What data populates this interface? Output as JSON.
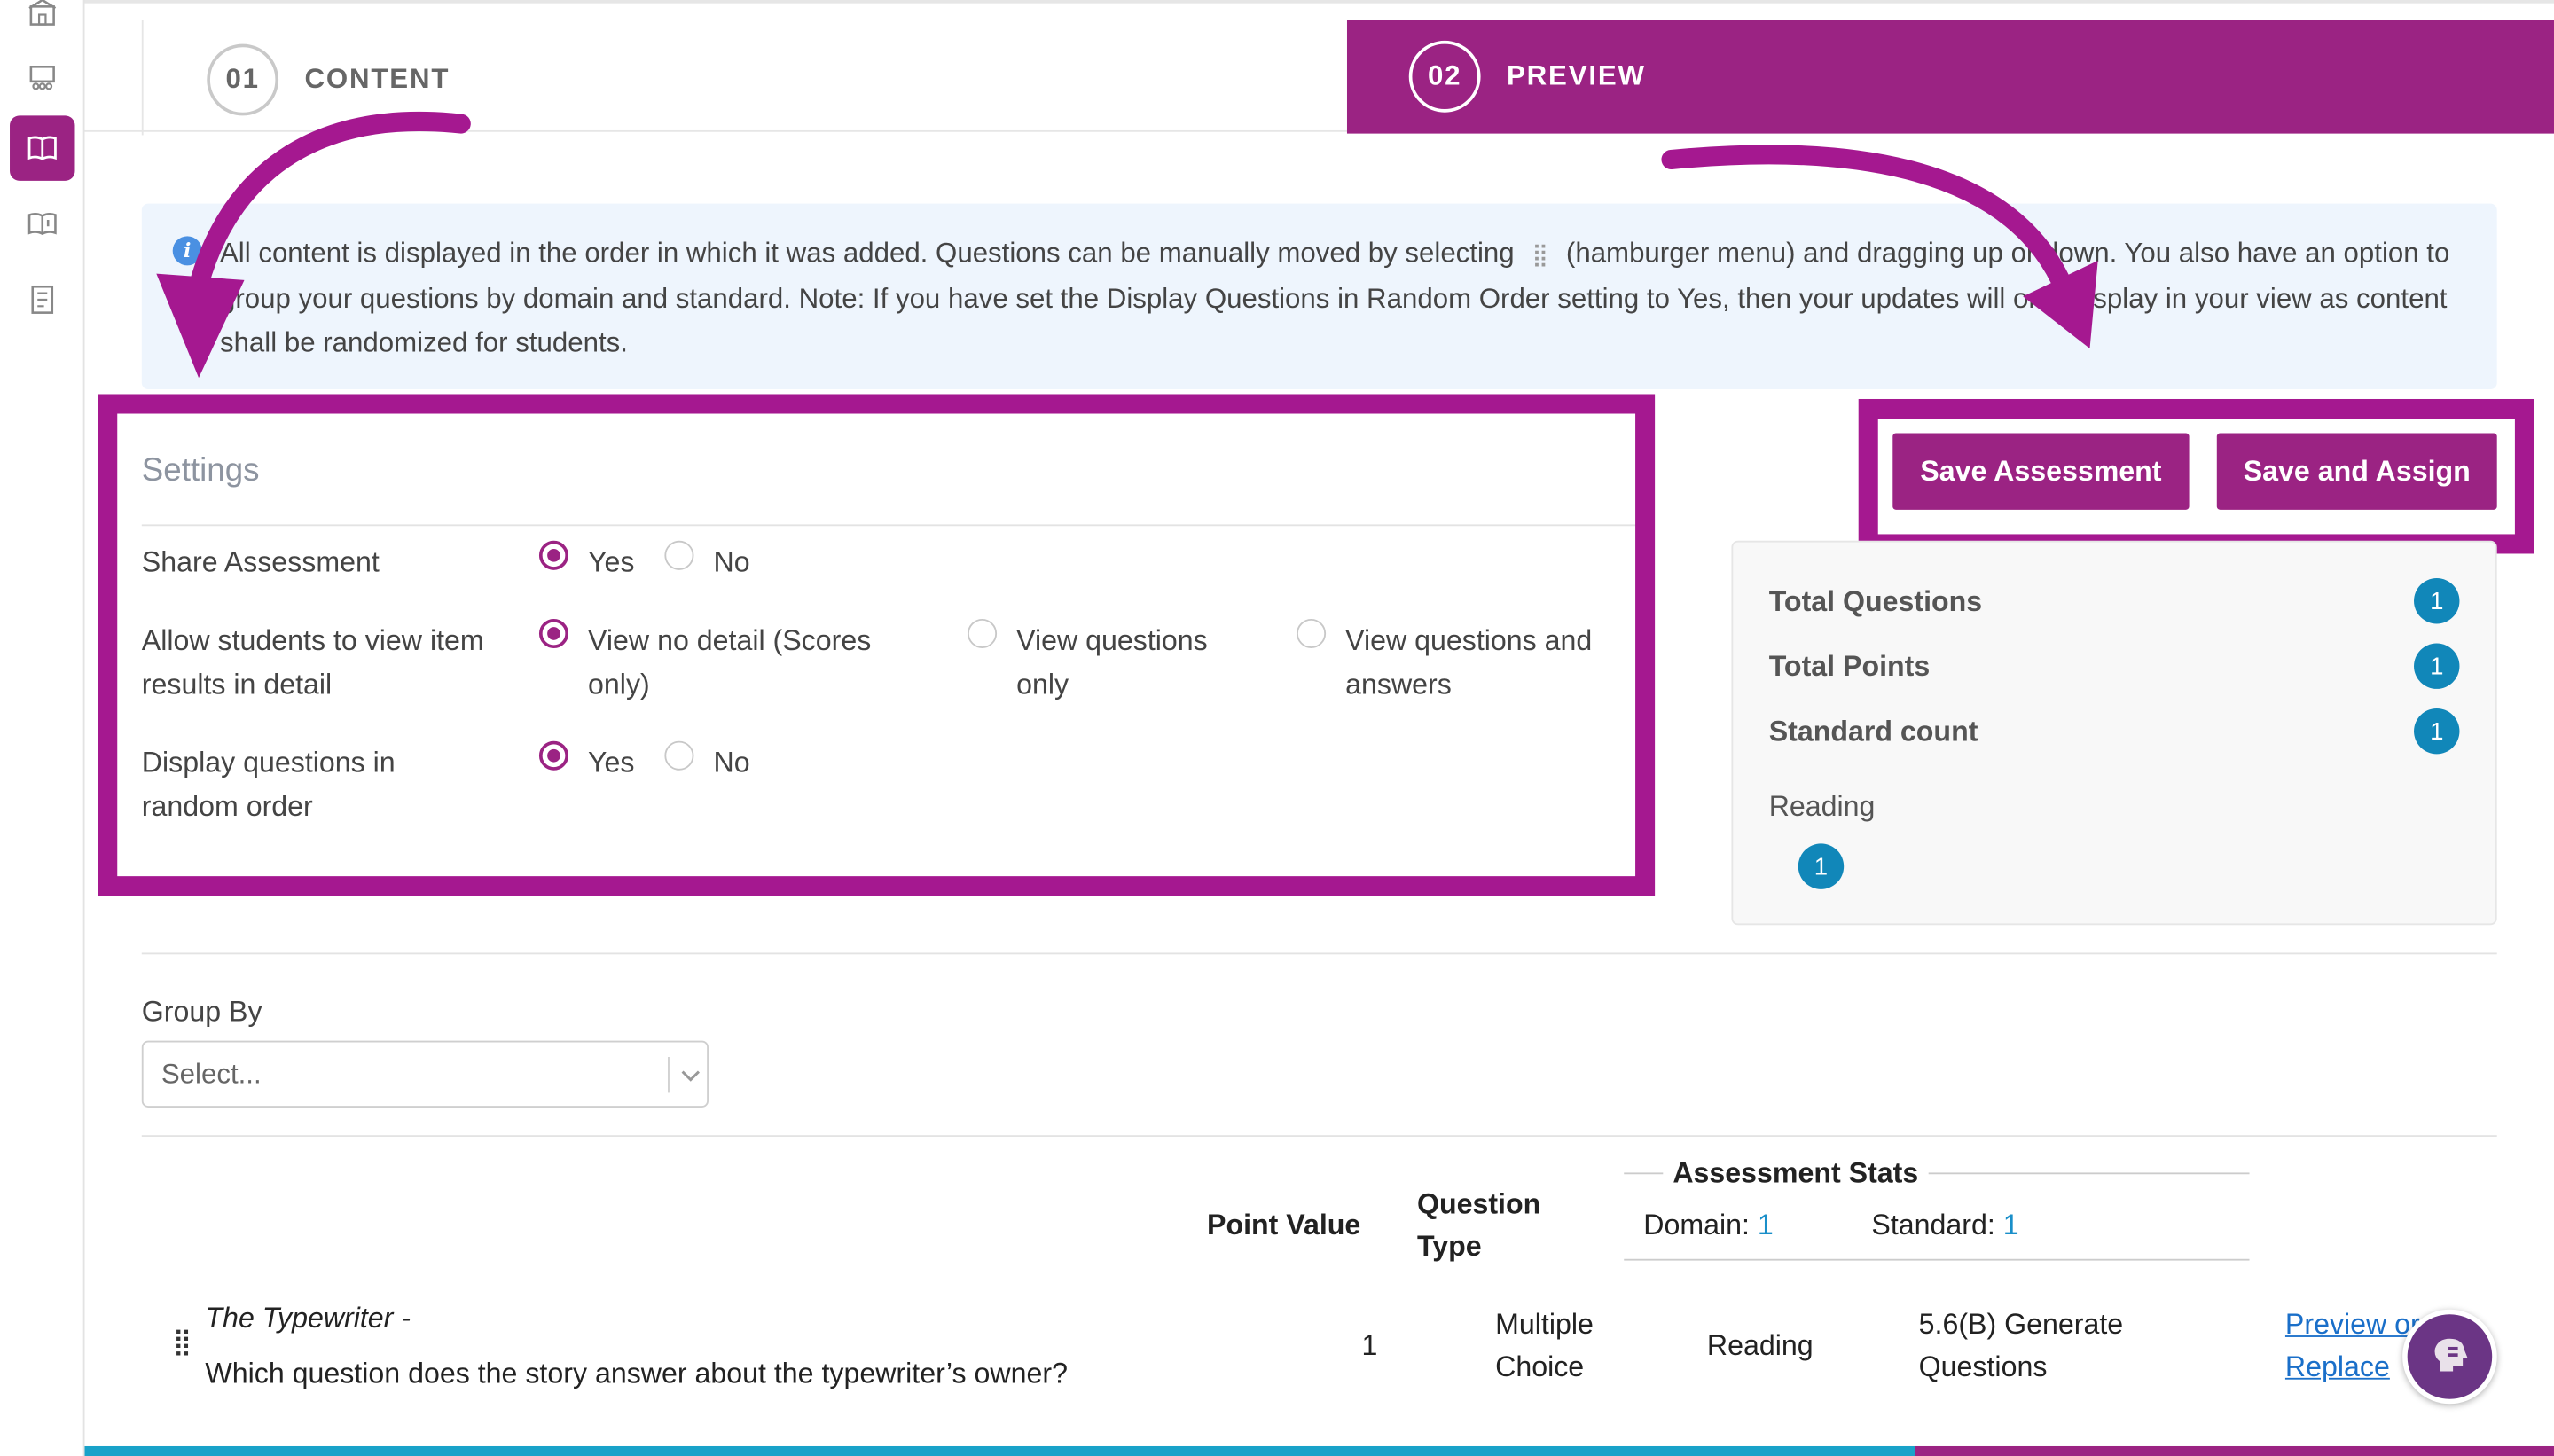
{
  "steps": [
    {
      "number": "01",
      "label": "CONTENT"
    },
    {
      "number": "02",
      "label": "PREVIEW"
    }
  ],
  "info": {
    "text_before": "All content is displayed in the order in which it was added. Questions can be manually moved by selecting",
    "text_after": "(hamburger menu) and dragging up or down. You also have an option to group your questions by domain and standard. Note: If you have set the Display Questions in Random Order setting to Yes, then your updates will only display in your view as content shall be randomized for students."
  },
  "settings": {
    "title": "Settings",
    "share": {
      "label": "Share Assessment",
      "options": [
        "Yes",
        "No"
      ],
      "selected": "Yes"
    },
    "view_results": {
      "label": "Allow students to view item results in detail",
      "options": [
        "View no detail (Scores only)",
        "View questions only",
        "View questions and answers"
      ],
      "selected": "View no detail (Scores only)"
    },
    "random_order": {
      "label": "Display questions in random order",
      "options": [
        "Yes",
        "No"
      ],
      "selected": "Yes"
    }
  },
  "buttons": {
    "save": "Save Assessment",
    "save_assign": "Save and Assign"
  },
  "stats": {
    "total_questions_label": "Total Questions",
    "total_questions": "1",
    "total_points_label": "Total Points",
    "total_points": "1",
    "standard_count_label": "Standard count",
    "standard_count": "1",
    "reading_label": "Reading",
    "reading_count": "1"
  },
  "group_by": {
    "label": "Group By",
    "placeholder": "Select..."
  },
  "table": {
    "headers": {
      "point_value": "Point Value",
      "question_type": "Question Type",
      "assessment_stats": "Assessment Stats",
      "domain_label": "Domain:",
      "domain_value": "1",
      "standard_label": "Standard:",
      "standard_value": "1"
    },
    "rows": [
      {
        "passage": "The Typewriter -",
        "question": "Which question does the story answer about the typewriter’s owner?",
        "points": "1",
        "type": "Multiple Choice",
        "domain": "Reading",
        "standard": "5.6(B) Generate Questions",
        "action": "Preview or Replace"
      }
    ]
  },
  "colors": {
    "brand": "#9b2383",
    "highlight": "#a51890",
    "badge": "#1187b9",
    "info_bg": "#eef5fd"
  }
}
